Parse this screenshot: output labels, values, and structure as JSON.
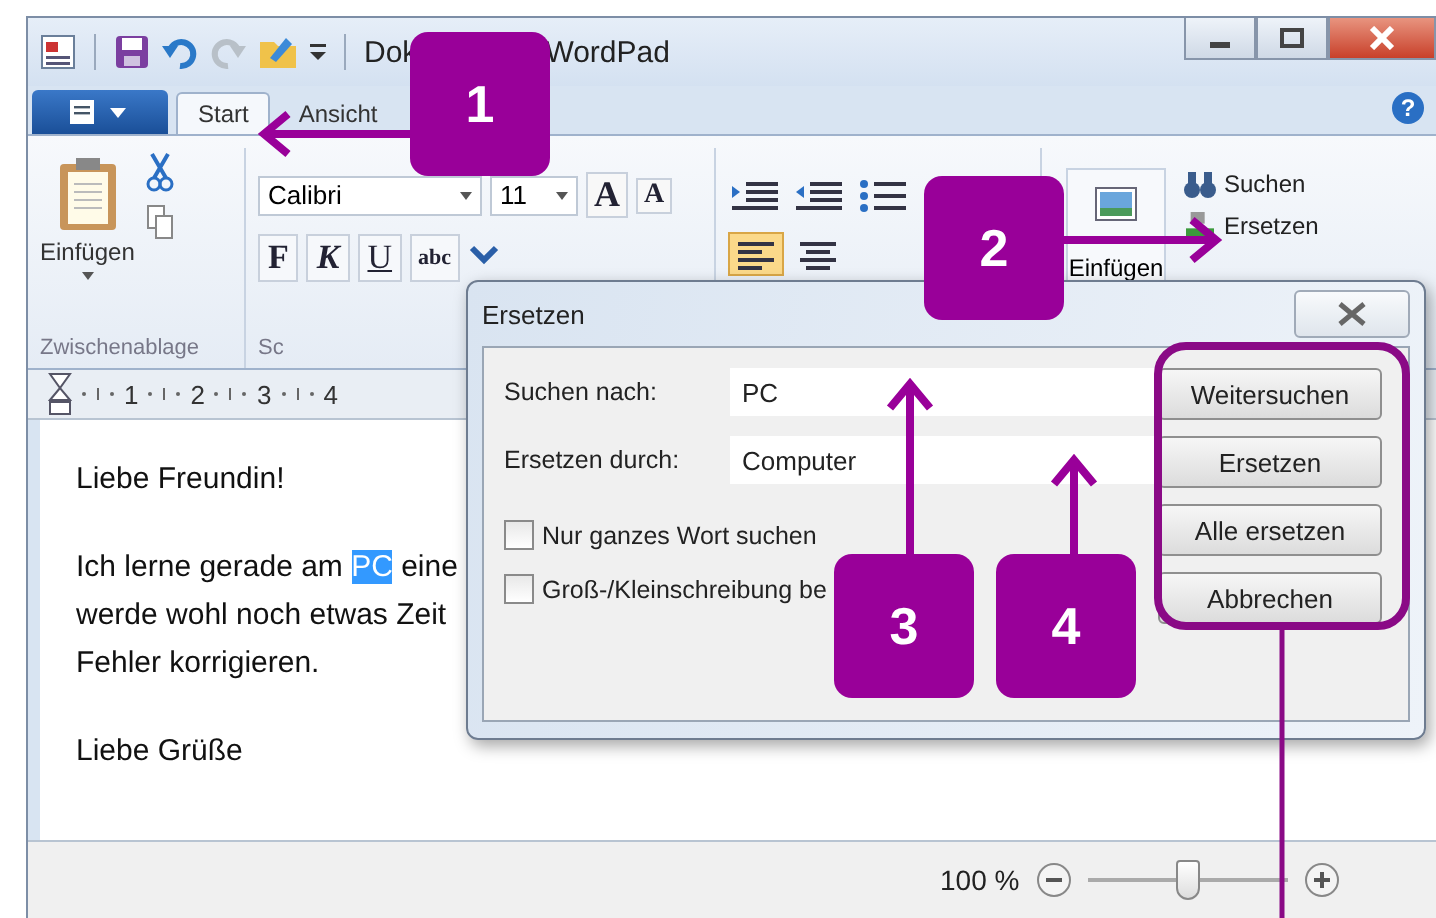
{
  "window": {
    "title_parts": [
      "Dok",
      "WordPad"
    ]
  },
  "help_glyph": "?",
  "tabs": [
    {
      "label": "Start",
      "selected": true
    },
    {
      "label": "Ansicht",
      "selected": false
    }
  ],
  "ribbon": {
    "paste_label": "Einfügen",
    "clipboard_group": "Zwischenablage",
    "font_family": "Calibri",
    "font_size": "11",
    "grow_glyphs": [
      "A",
      "A"
    ],
    "format_buttons": [
      "F",
      "K",
      "U",
      "abc"
    ],
    "font_group": "Sc",
    "insert_label": "Einfügen",
    "edit_items": [
      "Suchen",
      "Ersetzen"
    ]
  },
  "ruler": [
    "1",
    "2",
    "3",
    "4"
  ],
  "document": {
    "paragraphs": [
      {
        "lines": [
          {
            "segments": [
              {
                "text": "Liebe Freundin!",
                "selected": false
              }
            ]
          }
        ]
      },
      {
        "lines": [
          {
            "segments": [
              {
                "text": "Ich lerne gerade am ",
                "selected": false
              },
              {
                "text": "PC",
                "selected": true
              },
              {
                "text": " eine",
                "selected": false
              }
            ]
          },
          {
            "segments": [
              {
                "text": "werde wohl noch etwas Zeit",
                "selected": false
              }
            ]
          },
          {
            "segments": [
              {
                "text": "Fehler korrigieren.",
                "selected": false
              }
            ]
          }
        ]
      },
      {
        "lines": [
          {
            "segments": [
              {
                "text": "Liebe Grüße",
                "selected": false
              }
            ]
          }
        ]
      }
    ]
  },
  "status_bar": {
    "zoom": "100 %",
    "level": 0.5
  },
  "dialog": {
    "title": "Ersetzen",
    "fields": [
      {
        "label": "Suchen nach:",
        "value": "PC"
      },
      {
        "label": "Ersetzen durch:",
        "value": "Computer"
      }
    ],
    "options": [
      {
        "label": "Nur ganzes Wort suchen",
        "checked": false
      },
      {
        "label": "Groß-/Kleinschreibung be",
        "checked": false
      }
    ],
    "buttons": [
      "Weitersuchen",
      "Ersetzen",
      "Alle ersetzen",
      "Abbrechen"
    ]
  },
  "callouts": [
    {
      "number": "1"
    },
    {
      "number": "2"
    },
    {
      "number": "3"
    },
    {
      "number": "4"
    }
  ]
}
